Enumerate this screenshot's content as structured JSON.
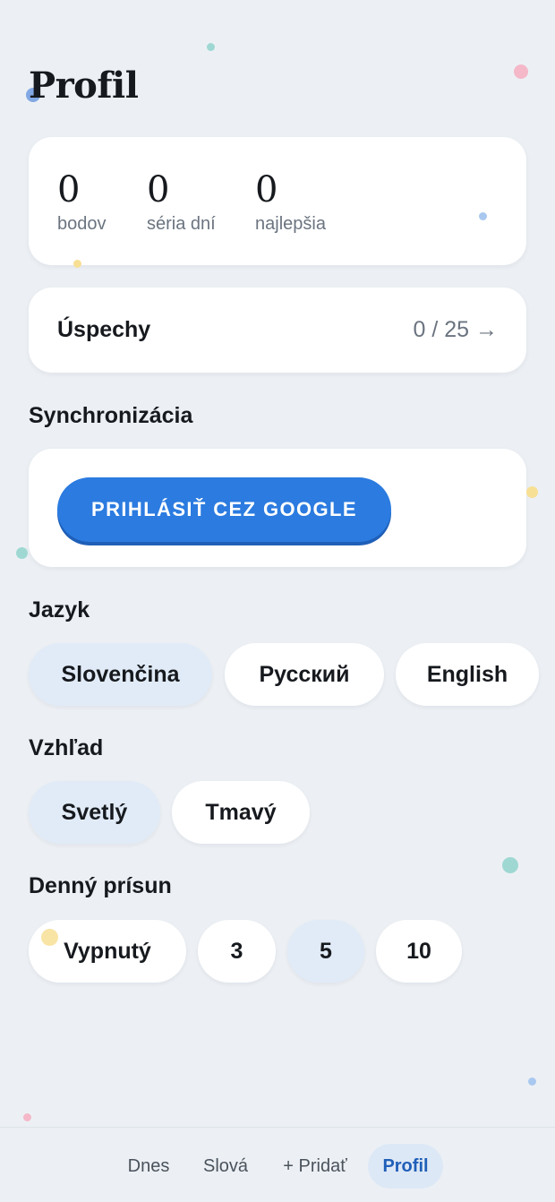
{
  "page": {
    "title": "Profil"
  },
  "stats": [
    {
      "value": "0",
      "label": "bodov"
    },
    {
      "value": "0",
      "label": "séria dní"
    },
    {
      "value": "0",
      "label": "najlepšia"
    }
  ],
  "achievements": {
    "label": "Úspechy",
    "count": "0 / 25 →"
  },
  "sync": {
    "heading": "Synchronizácia",
    "google_button": "PRIHLÁSIŤ CEZ GOOGLE"
  },
  "language": {
    "heading": "Jazyk",
    "options": [
      "Slovenčina",
      "Русский",
      "English"
    ],
    "selected": "Slovenčina"
  },
  "appearance": {
    "heading": "Vzhľad",
    "options": [
      "Svetlý",
      "Tmavý"
    ],
    "selected": "Svetlý"
  },
  "daily": {
    "heading": "Denný prísun",
    "options": [
      "Vypnutý",
      "3",
      "5",
      "10"
    ],
    "selected": "5"
  },
  "nav": {
    "items": [
      "Dnes",
      "Slová",
      "+ Pridať",
      "Profil"
    ],
    "active": "Profil"
  },
  "colors": {
    "accent": "#2b7be0",
    "background": "#ecf0f4",
    "active_pill": "#e1ebf7"
  }
}
